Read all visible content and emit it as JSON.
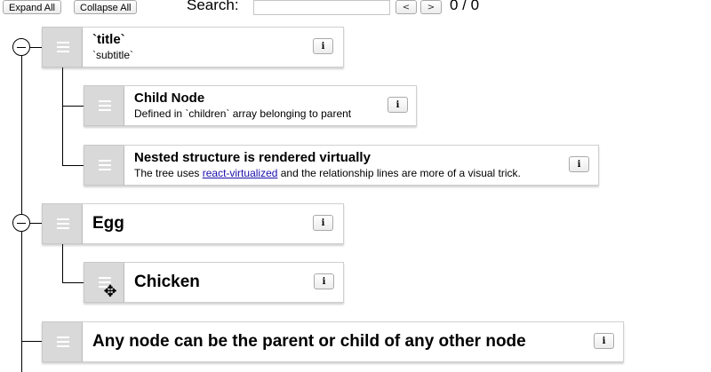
{
  "toolbar": {
    "expand_all": "Expand All",
    "collapse_all": "Collapse All",
    "search_label": "Search:",
    "search_value": "",
    "prev": "<",
    "next": ">",
    "match_count": "0 / 0"
  },
  "nodes": {
    "n1": {
      "title": "`title`",
      "subtitle": "`subtitle`",
      "info": "i"
    },
    "n2": {
      "title": "Child Node",
      "subtitle": "Defined in `children` array belonging to parent",
      "info": "i"
    },
    "n3": {
      "title": "Nested structure is rendered virtually",
      "subtitle_before": "The tree uses ",
      "subtitle_link": "react-virtualized",
      "subtitle_after": " and the relationship lines are more of a visual trick.",
      "info": "i"
    },
    "n4": {
      "title": "Egg",
      "info": "i"
    },
    "n5": {
      "title": "Chicken",
      "info": "i"
    },
    "n6": {
      "title": "Any node can be the parent or child of any other node",
      "info": "i"
    }
  },
  "icons": {
    "drag_handle": "hamburger-icon",
    "collapse": "minus-circle-icon",
    "move_cursor": "move-cursor-icon"
  },
  "colors": {
    "handle": "#d9d9d9",
    "link": "#1a0dab",
    "line": "#000000"
  }
}
